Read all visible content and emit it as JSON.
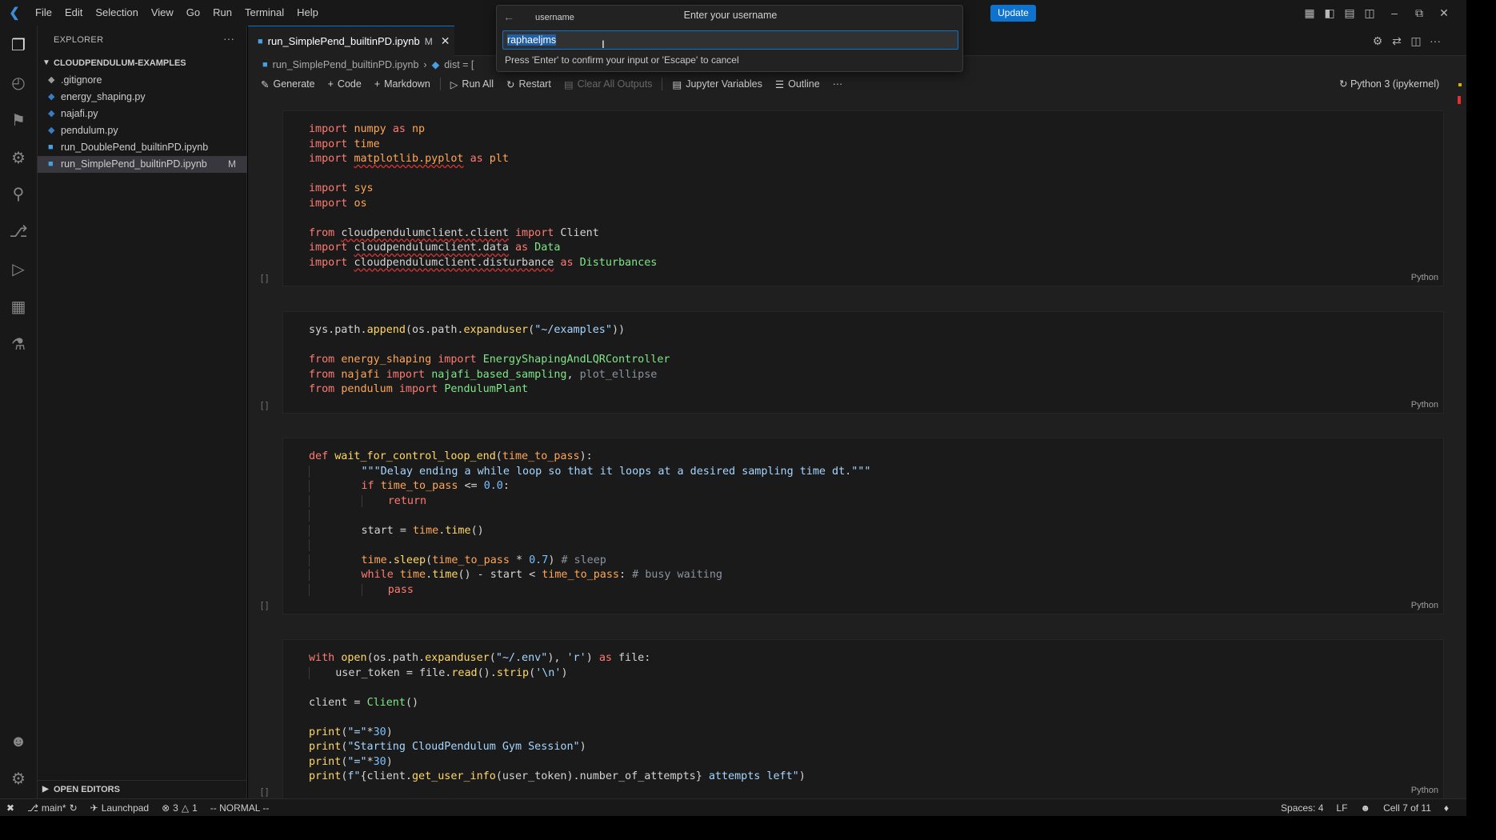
{
  "titlebar": {
    "menus": [
      "File",
      "Edit",
      "Selection",
      "View",
      "Go",
      "Run",
      "Terminal",
      "Help"
    ],
    "update_label": "Update"
  },
  "quick_input": {
    "tab_label": "username",
    "title": "Enter your username",
    "value": "raphaeljms",
    "hint": "Press 'Enter' to confirm your input or 'Escape' to cancel"
  },
  "sidebar": {
    "title": "EXPLORER",
    "folder": "CLOUDPENDULUM-EXAMPLES",
    "files": [
      {
        "name": ".gitignore",
        "badge": ""
      },
      {
        "name": "energy_shaping.py",
        "badge": ""
      },
      {
        "name": "najafi.py",
        "badge": ""
      },
      {
        "name": "pendulum.py",
        "badge": ""
      },
      {
        "name": "run_DoublePend_builtinPD.ipynb",
        "badge": ""
      },
      {
        "name": "run_SimplePend_builtinPD.ipynb",
        "badge": "M"
      }
    ],
    "open_editors": "OPEN EDITORS"
  },
  "editor": {
    "tab": {
      "label": "run_SimplePend_builtinPD.ipynb",
      "modified": "M"
    },
    "breadcrumb": {
      "file": "run_SimplePend_builtinPD.ipynb",
      "symbol": "dist = ["
    },
    "toolbar": {
      "generate": "Generate",
      "code": "Code",
      "markdown": "Markdown",
      "run_all": "Run All",
      "restart": "Restart",
      "clear_outputs": "Clear All Outputs",
      "variables": "Jupyter Variables",
      "outline": "Outline",
      "more": "···"
    },
    "kernel": "Python 3 (ipykernel)",
    "cell_language": "Python",
    "cell_bracket": "[ ]"
  },
  "statusbar": {
    "branch": "main*",
    "launchpad": "Launchpad",
    "errors": "3",
    "warnings": "1",
    "mode": "-- NORMAL --",
    "spaces": "Spaces: 4",
    "eol": "LF",
    "cell_pos": "Cell 7 of 11"
  },
  "colors": {
    "accent": "#0e73cc",
    "background": "#1f1f1f",
    "sidebar": "#181818"
  }
}
